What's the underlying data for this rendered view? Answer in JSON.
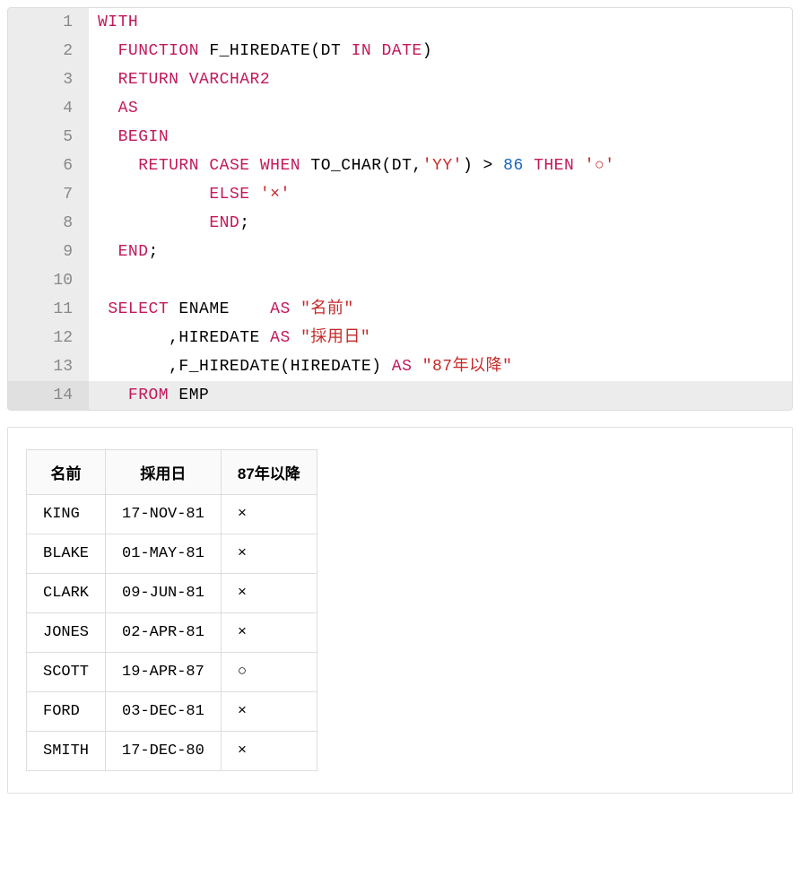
{
  "code": {
    "lines": [
      {
        "n": 1,
        "tokens": [
          {
            "t": "WITH",
            "c": "kw"
          }
        ]
      },
      {
        "n": 2,
        "tokens": [
          {
            "t": "  ",
            "c": ""
          },
          {
            "t": "FUNCTION",
            "c": "kw"
          },
          {
            "t": " F_HIREDATE(DT ",
            "c": "fn"
          },
          {
            "t": "IN",
            "c": "kw"
          },
          {
            "t": " ",
            "c": ""
          },
          {
            "t": "DATE",
            "c": "kw"
          },
          {
            "t": ")",
            "c": "paren"
          }
        ]
      },
      {
        "n": 3,
        "tokens": [
          {
            "t": "  ",
            "c": ""
          },
          {
            "t": "RETURN",
            "c": "kw"
          },
          {
            "t": " ",
            "c": ""
          },
          {
            "t": "VARCHAR2",
            "c": "kw"
          }
        ]
      },
      {
        "n": 4,
        "tokens": [
          {
            "t": "  ",
            "c": ""
          },
          {
            "t": "AS",
            "c": "kw"
          }
        ]
      },
      {
        "n": 5,
        "tokens": [
          {
            "t": "  ",
            "c": ""
          },
          {
            "t": "BEGIN",
            "c": "kw"
          }
        ]
      },
      {
        "n": 6,
        "tokens": [
          {
            "t": "    ",
            "c": ""
          },
          {
            "t": "RETURN",
            "c": "kw"
          },
          {
            "t": " ",
            "c": ""
          },
          {
            "t": "CASE",
            "c": "kw"
          },
          {
            "t": " ",
            "c": ""
          },
          {
            "t": "WHEN",
            "c": "kw"
          },
          {
            "t": " TO_CHAR(DT,",
            "c": "fn"
          },
          {
            "t": "'YY'",
            "c": "str"
          },
          {
            "t": ") > ",
            "c": "fn"
          },
          {
            "t": "86",
            "c": "num"
          },
          {
            "t": " ",
            "c": ""
          },
          {
            "t": "THEN",
            "c": "kw"
          },
          {
            "t": " ",
            "c": ""
          },
          {
            "t": "'○'",
            "c": "str"
          }
        ]
      },
      {
        "n": 7,
        "tokens": [
          {
            "t": "           ",
            "c": ""
          },
          {
            "t": "ELSE",
            "c": "kw"
          },
          {
            "t": " ",
            "c": ""
          },
          {
            "t": "'×'",
            "c": "str"
          }
        ]
      },
      {
        "n": 8,
        "tokens": [
          {
            "t": "           ",
            "c": ""
          },
          {
            "t": "END",
            "c": "kw"
          },
          {
            "t": ";",
            "c": "op"
          }
        ]
      },
      {
        "n": 9,
        "tokens": [
          {
            "t": "  ",
            "c": ""
          },
          {
            "t": "END",
            "c": "kw"
          },
          {
            "t": ";",
            "c": "op"
          }
        ]
      },
      {
        "n": 10,
        "tokens": []
      },
      {
        "n": 11,
        "tokens": [
          {
            "t": " ",
            "c": ""
          },
          {
            "t": "SELECT",
            "c": "kw"
          },
          {
            "t": " ENAME    ",
            "c": "fn"
          },
          {
            "t": "AS",
            "c": "kw"
          },
          {
            "t": " ",
            "c": ""
          },
          {
            "t": "\"名前\"",
            "c": "str"
          }
        ]
      },
      {
        "n": 12,
        "tokens": [
          {
            "t": "       ,HIREDATE ",
            "c": "fn"
          },
          {
            "t": "AS",
            "c": "kw"
          },
          {
            "t": " ",
            "c": ""
          },
          {
            "t": "\"採用日\"",
            "c": "str"
          }
        ]
      },
      {
        "n": 13,
        "tokens": [
          {
            "t": "       ,F_HIREDATE(HIREDATE) ",
            "c": "fn"
          },
          {
            "t": "AS",
            "c": "kw"
          },
          {
            "t": " ",
            "c": ""
          },
          {
            "t": "\"87年以降\"",
            "c": "str"
          }
        ]
      },
      {
        "n": 14,
        "tokens": [
          {
            "t": "   ",
            "c": ""
          },
          {
            "t": "FROM",
            "c": "kw"
          },
          {
            "t": " EMP",
            "c": "fn"
          }
        ],
        "highlight": true
      }
    ]
  },
  "results": {
    "headers": [
      "名前",
      "採用日",
      "87年以降"
    ],
    "rows": [
      [
        "KING",
        "17-NOV-81",
        "×"
      ],
      [
        "BLAKE",
        "01-MAY-81",
        "×"
      ],
      [
        "CLARK",
        "09-JUN-81",
        "×"
      ],
      [
        "JONES",
        "02-APR-81",
        "×"
      ],
      [
        "SCOTT",
        "19-APR-87",
        "○"
      ],
      [
        "FORD",
        "03-DEC-81",
        "×"
      ],
      [
        "SMITH",
        "17-DEC-80",
        "×"
      ]
    ]
  }
}
